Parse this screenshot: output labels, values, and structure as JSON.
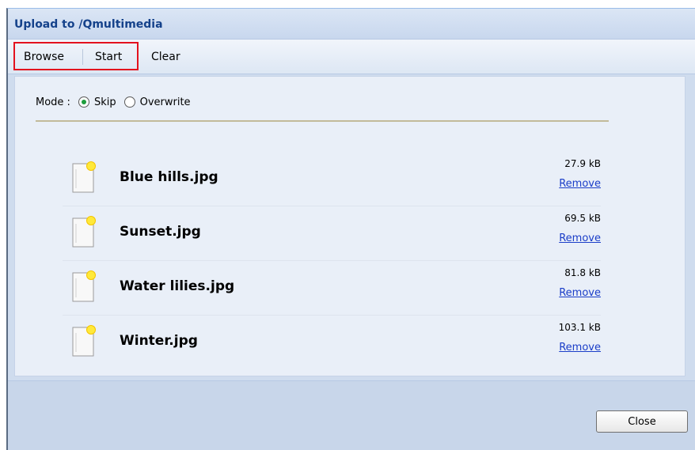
{
  "dialog": {
    "title": "Upload to /Qmultimedia"
  },
  "toolbar": {
    "browse_label": "Browse",
    "start_label": "Start",
    "clear_label": "Clear"
  },
  "mode": {
    "label": "Mode :",
    "options": [
      "Skip",
      "Overwrite"
    ],
    "selected": "Skip"
  },
  "files": [
    {
      "name": "Blue hills.jpg",
      "size": "27.9 kB",
      "remove_label": "Remove"
    },
    {
      "name": "Sunset.jpg",
      "size": "69.5 kB",
      "remove_label": "Remove"
    },
    {
      "name": "Water lilies.jpg",
      "size": "81.8 kB",
      "remove_label": "Remove"
    },
    {
      "name": "Winter.jpg",
      "size": "103.1 kB",
      "remove_label": "Remove"
    }
  ],
  "footer": {
    "close_label": "Close"
  },
  "icons": {
    "file_icon": "file-icon"
  },
  "colors": {
    "highlight": "#e3121e",
    "link": "#1a3dc8",
    "title": "#15428b",
    "radio_selected": "#1e9e3e"
  }
}
